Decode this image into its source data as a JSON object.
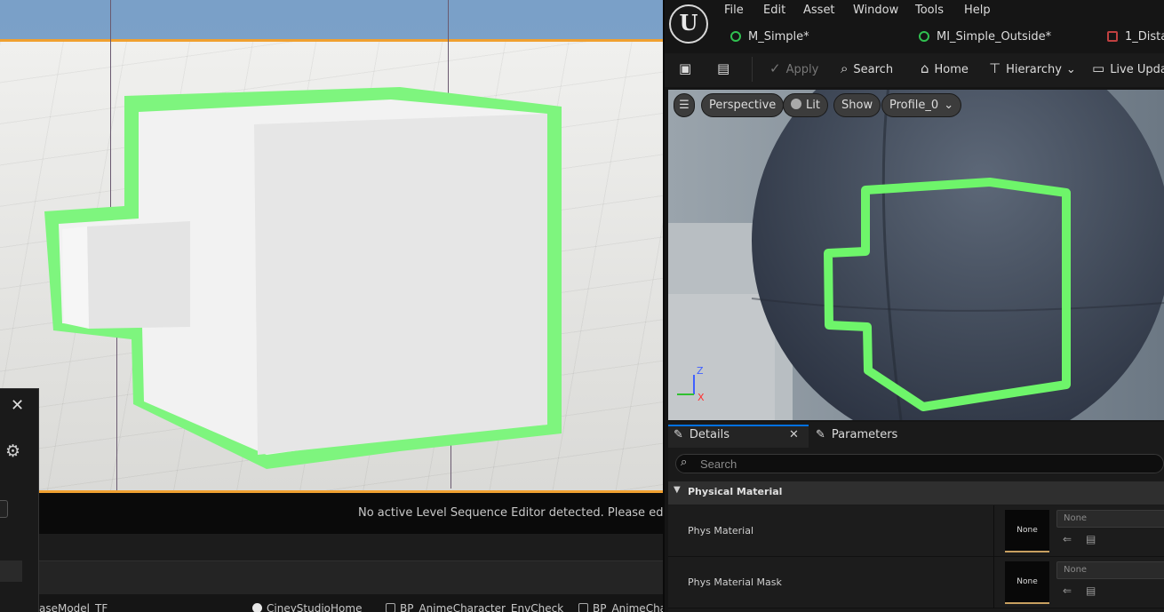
{
  "level_editor": {
    "sequence_message": "No active Level Sequence Editor detected. Please edit a Leve",
    "bottom_tabs": [
      {
        "label": "aseModel_TF"
      },
      {
        "label": "CineyStudioHome"
      },
      {
        "label": "BP_AnimeCharacter_EnvCheck"
      },
      {
        "label": "BP_AnimeCha"
      }
    ],
    "outline_color": "#7ef57e"
  },
  "material_editor": {
    "menu": [
      "File",
      "Edit",
      "Asset",
      "Window",
      "Tools",
      "Help"
    ],
    "document_tabs": [
      "M_Simple*",
      "MI_Simple_Outside*",
      "1_Dista"
    ],
    "toolbar": {
      "apply": "Apply",
      "search": "Search",
      "home": "Home",
      "hierarchy": "Hierarchy",
      "live_update": "Live Upda"
    },
    "viewport": {
      "view_mode": "Perspective",
      "lighting": "Lit",
      "show": "Show",
      "profile": "Profile_0",
      "axis_z": "Z",
      "axis_x": "X"
    },
    "panels": {
      "details_tab": "Details",
      "parameters_tab": "Parameters",
      "search_placeholder": "Search",
      "category": "Physical Material",
      "properties": [
        {
          "label": "Phys Material",
          "thumb": "None",
          "value": "None"
        },
        {
          "label": "Phys Material Mask",
          "thumb": "None",
          "value": "None"
        }
      ]
    }
  }
}
